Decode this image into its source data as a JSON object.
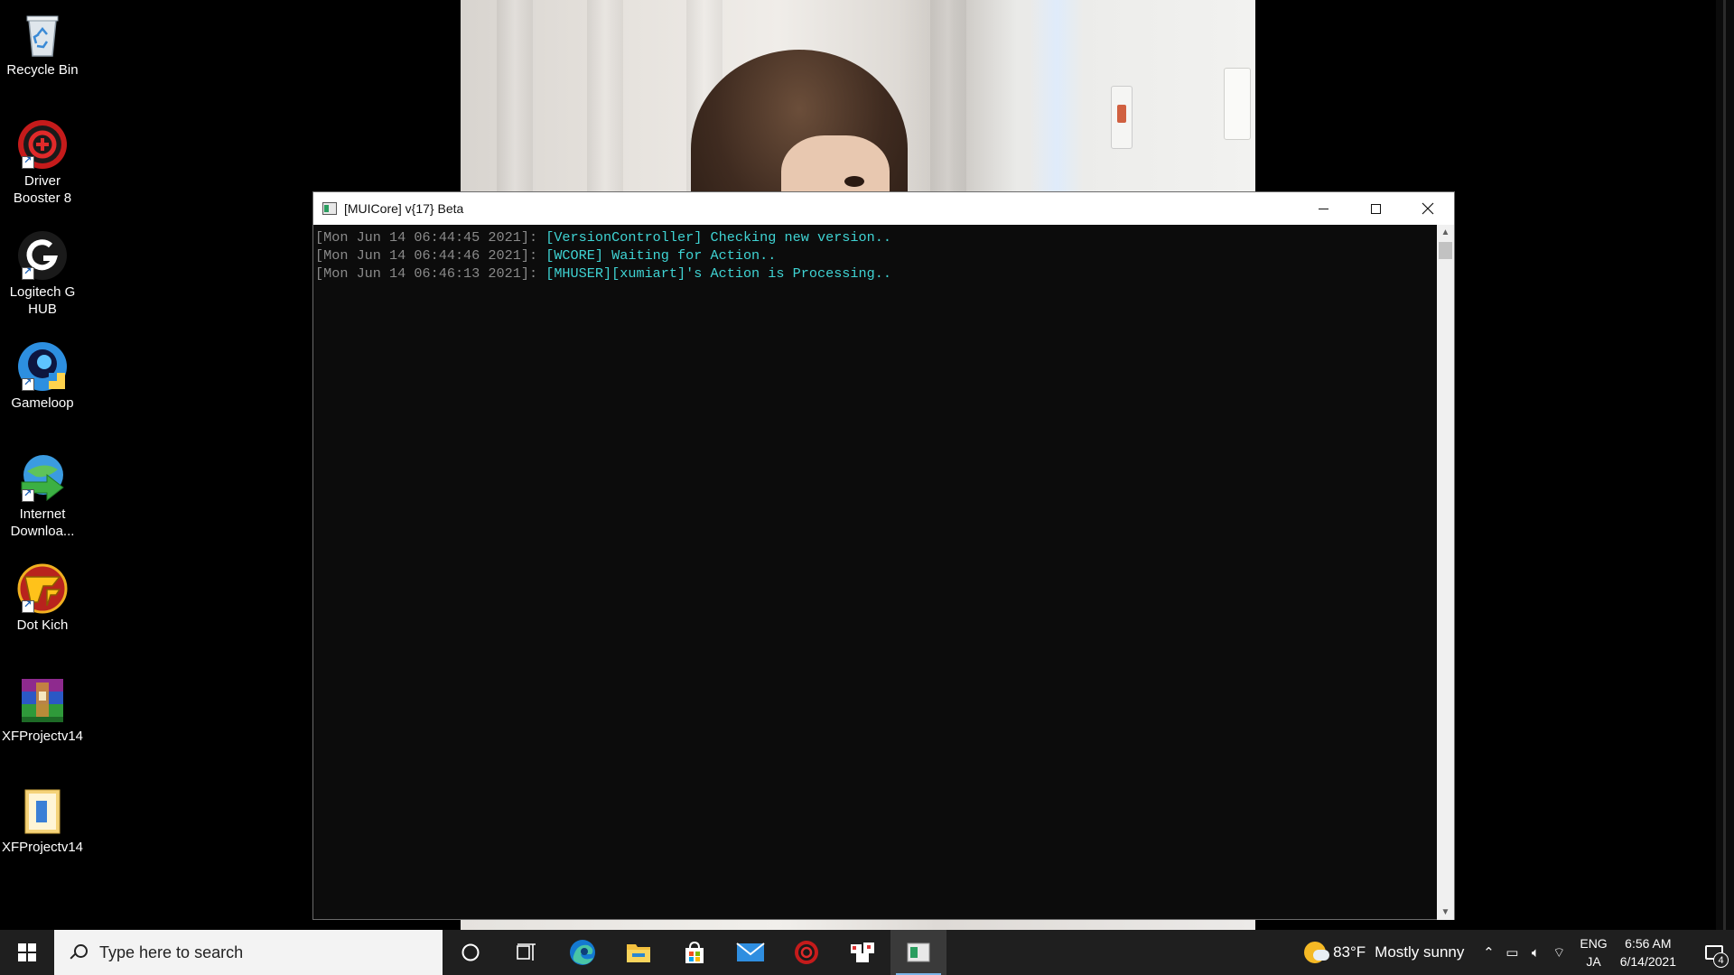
{
  "desktop": {
    "icons": [
      {
        "label": "Recycle Bin",
        "icon": "recycle-bin-icon"
      },
      {
        "label": "Driver Booster 8",
        "icon": "driver-booster-icon"
      },
      {
        "label": "Logitech G HUB",
        "icon": "logitech-g-hub-icon"
      },
      {
        "label": "Gameloop",
        "icon": "gameloop-icon"
      },
      {
        "label": "Internet Downloa...",
        "icon": "internet-download-manager-icon"
      },
      {
        "label": "Dot Kich",
        "icon": "dot-kich-icon"
      },
      {
        "label": "XFProjectv14",
        "icon": "winrar-archive-icon"
      },
      {
        "label": "XFProjectv14",
        "icon": "folder-icon"
      }
    ]
  },
  "console": {
    "title": "[MUICore] v{17} Beta",
    "colors": {
      "timestamp": "#8a8a8a",
      "message": "#3fd3d3",
      "background": "#0c0c0c"
    },
    "lines": [
      {
        "timestamp": "[Mon Jun 14 06:44:45 2021]:",
        "message": "[VersionController] Checking new version.."
      },
      {
        "timestamp": "[Mon Jun 14 06:44:46 2021]:",
        "message": "[WCORE] Waiting for Action.."
      },
      {
        "timestamp": "[Mon Jun 14 06:46:13 2021]:",
        "message": "[MHUSER][xumiart]'s Action is Processing.."
      }
    ]
  },
  "taskbar": {
    "search_placeholder": "Type here to search",
    "pinned": [
      "cortana-icon",
      "task-view-icon",
      "edge-icon",
      "file-explorer-icon",
      "store-icon",
      "mail-icon",
      "driver-booster-icon",
      "app-icon",
      "console-app-icon"
    ],
    "weather": {
      "temp": "83°F",
      "condition": "Mostly sunny"
    },
    "language": {
      "line1": "ENG",
      "line2": "JA"
    },
    "clock": {
      "time": "6:56 AM",
      "date": "6/14/2021"
    },
    "notifications": "4"
  }
}
